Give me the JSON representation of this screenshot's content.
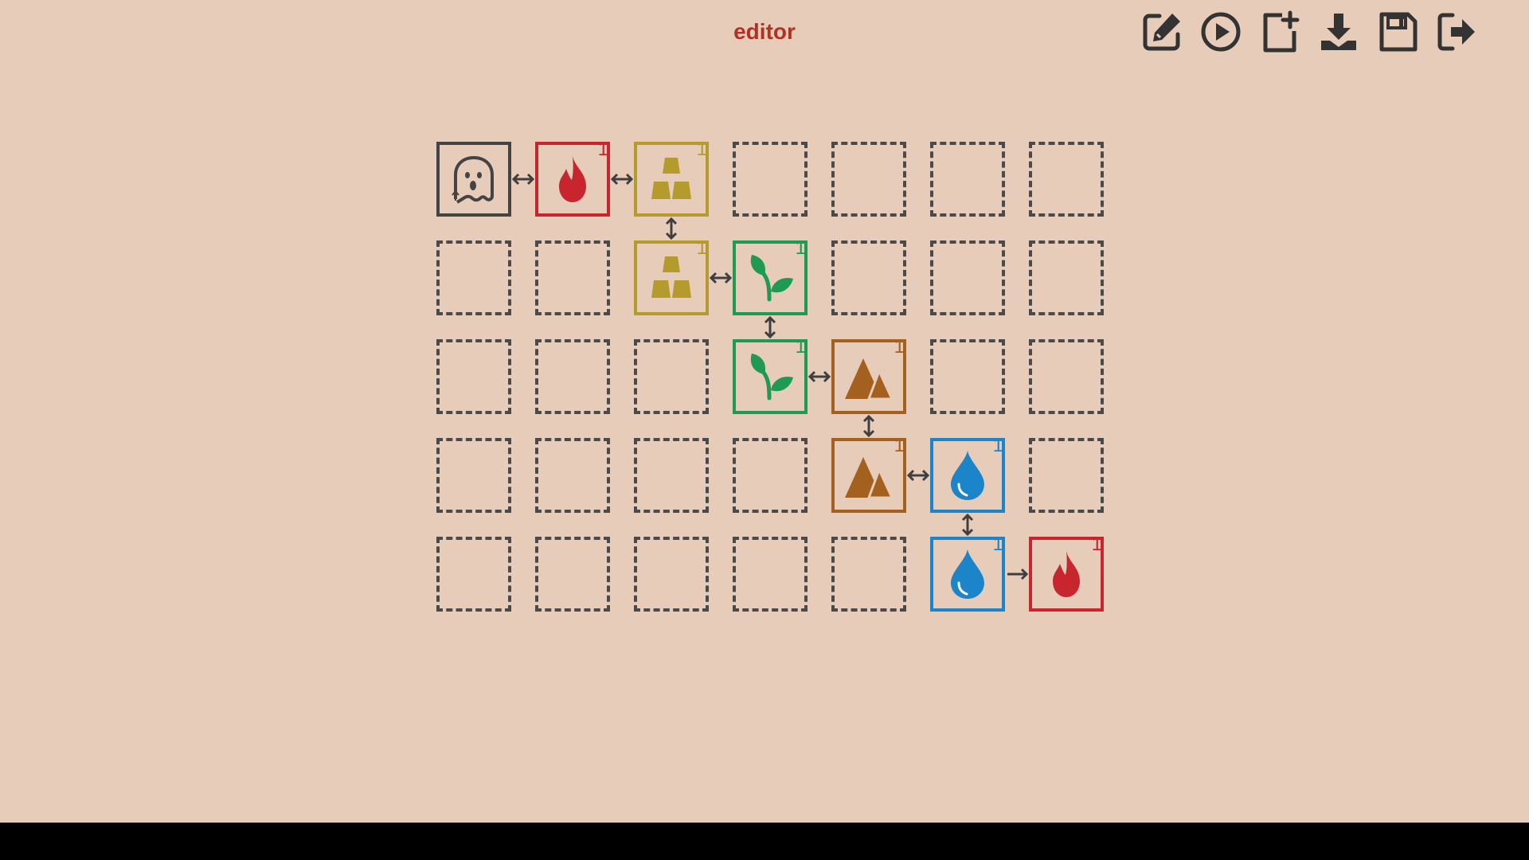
{
  "header": {
    "title": "editor"
  },
  "toolbar": {
    "buttons": [
      {
        "name": "edit-button",
        "icon": "edit-icon"
      },
      {
        "name": "play-button",
        "icon": "play-icon"
      },
      {
        "name": "new-button",
        "icon": "new-file-icon"
      },
      {
        "name": "download-button",
        "icon": "download-icon"
      },
      {
        "name": "save-button",
        "icon": "save-icon"
      },
      {
        "name": "exit-button",
        "icon": "exit-icon"
      }
    ]
  },
  "board": {
    "cols": 7,
    "rows": 5,
    "colors": {
      "ghost": "#444444",
      "fire": "#c8262e",
      "gold": "#b59a2e",
      "plant": "#1e9a53",
      "mountain": "#a3601f",
      "water": "#1c84c8",
      "empty": "#4a4a4a",
      "connector": "#3f3f3f"
    },
    "tiles": [
      {
        "row": 0,
        "col": 0,
        "type": "ghost",
        "icon": "ghost-icon",
        "count": ""
      },
      {
        "row": 0,
        "col": 1,
        "type": "fire",
        "icon": "fire-icon",
        "count": "1"
      },
      {
        "row": 0,
        "col": 2,
        "type": "gold",
        "icon": "gold-bars-icon",
        "count": "1"
      },
      {
        "row": 1,
        "col": 2,
        "type": "gold",
        "icon": "gold-bars-icon",
        "count": "1"
      },
      {
        "row": 1,
        "col": 3,
        "type": "plant",
        "icon": "sprout-icon",
        "count": "1"
      },
      {
        "row": 2,
        "col": 3,
        "type": "plant",
        "icon": "sprout-icon",
        "count": "1"
      },
      {
        "row": 2,
        "col": 4,
        "type": "mountain",
        "icon": "mountain-icon",
        "count": "1"
      },
      {
        "row": 3,
        "col": 4,
        "type": "mountain",
        "icon": "mountain-icon",
        "count": "1"
      },
      {
        "row": 3,
        "col": 5,
        "type": "water",
        "icon": "water-drop-icon",
        "count": "1"
      },
      {
        "row": 4,
        "col": 5,
        "type": "water",
        "icon": "water-drop-icon",
        "count": "1"
      },
      {
        "row": 4,
        "col": 6,
        "type": "fire",
        "icon": "fire-icon",
        "count": "1"
      }
    ],
    "links": [
      {
        "from": [
          0,
          0
        ],
        "to": [
          0,
          1
        ],
        "direction": "both"
      },
      {
        "from": [
          0,
          1
        ],
        "to": [
          0,
          2
        ],
        "direction": "both"
      },
      {
        "from": [
          0,
          2
        ],
        "to": [
          1,
          2
        ],
        "direction": "both"
      },
      {
        "from": [
          1,
          2
        ],
        "to": [
          1,
          3
        ],
        "direction": "both"
      },
      {
        "from": [
          1,
          3
        ],
        "to": [
          2,
          3
        ],
        "direction": "both"
      },
      {
        "from": [
          2,
          3
        ],
        "to": [
          2,
          4
        ],
        "direction": "both"
      },
      {
        "from": [
          2,
          4
        ],
        "to": [
          3,
          4
        ],
        "direction": "both"
      },
      {
        "from": [
          3,
          4
        ],
        "to": [
          3,
          5
        ],
        "direction": "both"
      },
      {
        "from": [
          3,
          5
        ],
        "to": [
          4,
          5
        ],
        "direction": "both"
      },
      {
        "from": [
          4,
          5
        ],
        "to": [
          4,
          6
        ],
        "direction": "forward"
      }
    ]
  }
}
